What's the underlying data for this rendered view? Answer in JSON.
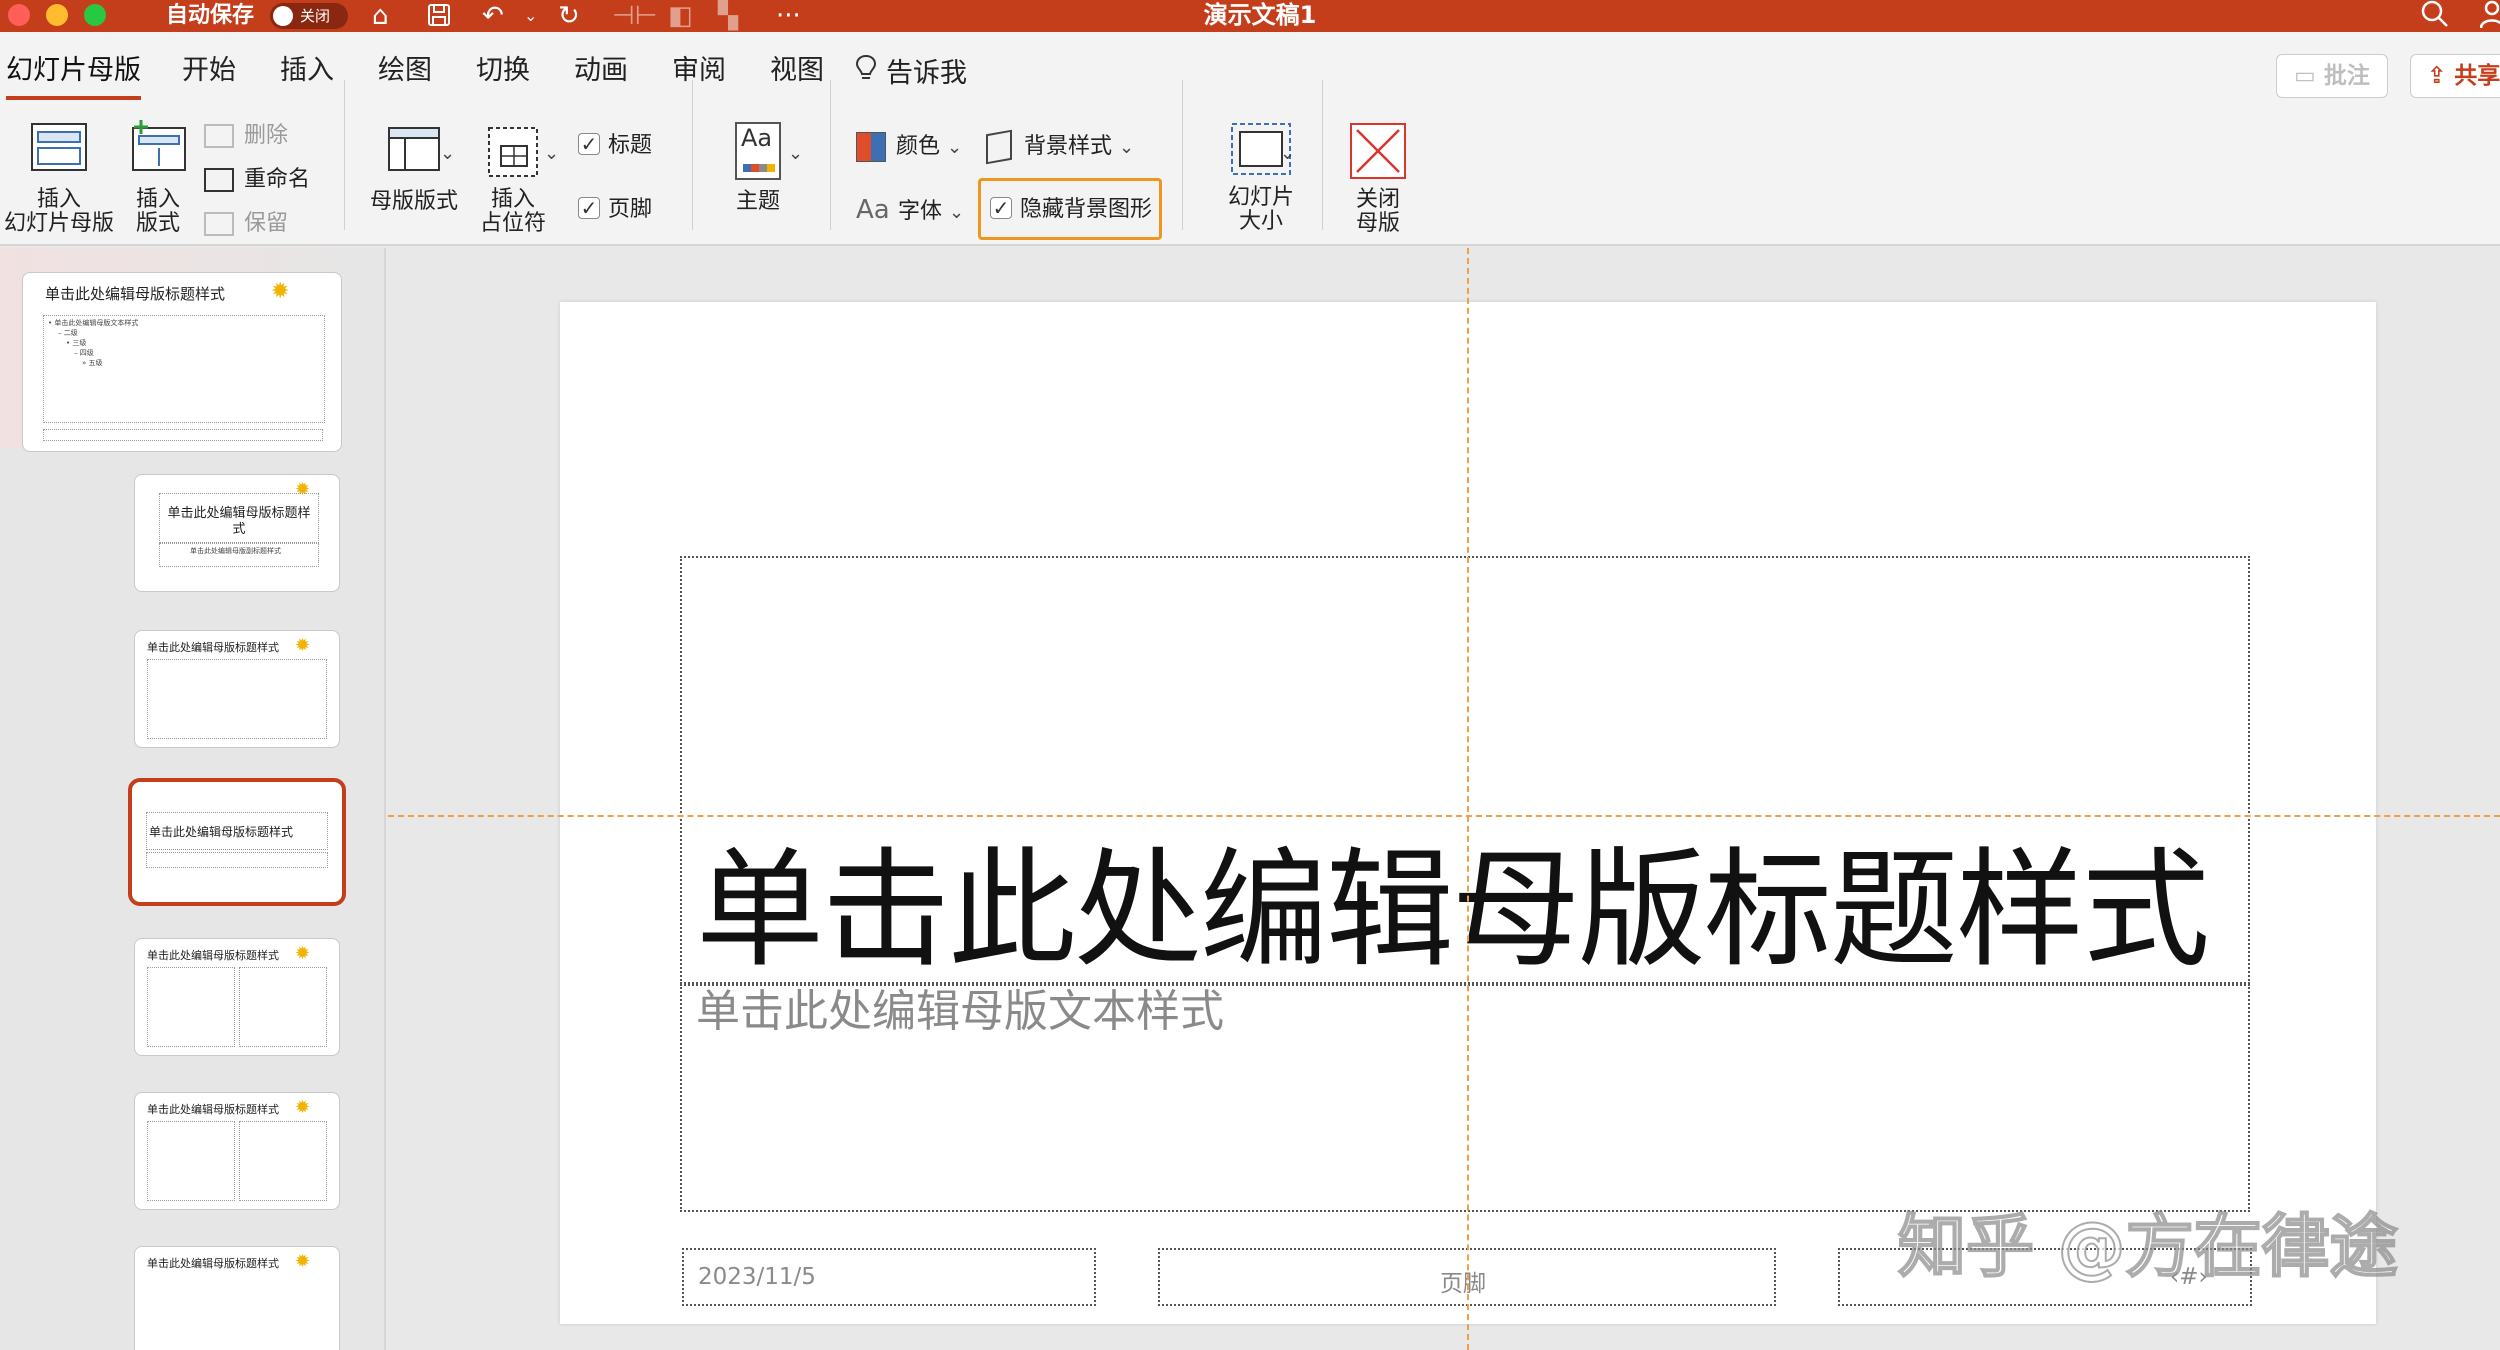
{
  "window": {
    "title": "演示文稿1",
    "autosave_label": "自动保存",
    "autosave_state": "关闭"
  },
  "quick_access": [
    "home-icon",
    "save-icon",
    "undo-icon",
    "redo-icon",
    "more-icon"
  ],
  "tabs": [
    {
      "label": "幻灯片母版",
      "active": true
    },
    {
      "label": "开始"
    },
    {
      "label": "插入"
    },
    {
      "label": "绘图"
    },
    {
      "label": "切换"
    },
    {
      "label": "动画"
    },
    {
      "label": "审阅"
    },
    {
      "label": "视图"
    },
    {
      "label": "告诉我"
    }
  ],
  "header_buttons": {
    "comments": "批注",
    "share": "共享"
  },
  "ribbon": {
    "insert_master": {
      "line1": "插入",
      "line2": "幻灯片母版"
    },
    "insert_layout": {
      "line1": "插入",
      "line2": "版式"
    },
    "delete": "删除",
    "rename": "重命名",
    "preserve": "保留",
    "master_layout": "母版版式",
    "insert_placeholder": {
      "line1": "插入",
      "line2": "占位符"
    },
    "title_check": "标题",
    "footer_check": "页脚",
    "theme": "主题",
    "theme_glyph": "Aa",
    "colors": "颜色",
    "fonts_glyph": "Aa",
    "fonts": "字体",
    "background_styles": "背景样式",
    "hide_background_graphics": "隐藏背景图形",
    "slide_size": {
      "line1": "幻灯片",
      "line2": "大小"
    },
    "close_master": {
      "line1": "关闭",
      "line2": "母版"
    }
  },
  "thumbnails": [
    {
      "title": "单击此处编辑母版标题样式",
      "body": [
        "• 单击此处编辑母版文本样式",
        "– 二级",
        "• 三级",
        "– 四级",
        "» 五级"
      ]
    },
    {
      "title": "单击此处编辑母版标题样式",
      "subtitle": "单击此处编辑母版副标题样式"
    },
    {
      "title": "单击此处编辑母版标题样式"
    },
    {
      "title": "单击此处编辑母版标题样式",
      "selected": true
    },
    {
      "title": "单击此处编辑母版标题样式"
    },
    {
      "title": "单击此处编辑母版标题样式"
    },
    {
      "title": "单击此处编辑母版标题样式"
    }
  ],
  "slide": {
    "title": "单击此处编辑母版标题样式",
    "subtitle": "单击此处编辑母版文本样式",
    "date": "2023/11/5",
    "footer": "页脚",
    "slide_number": "‹#›"
  },
  "watermark": "知乎 @方在律途",
  "colors": {
    "accent": "#c43e1c",
    "highlight": "#f0951e",
    "guide": "#eba14a"
  }
}
